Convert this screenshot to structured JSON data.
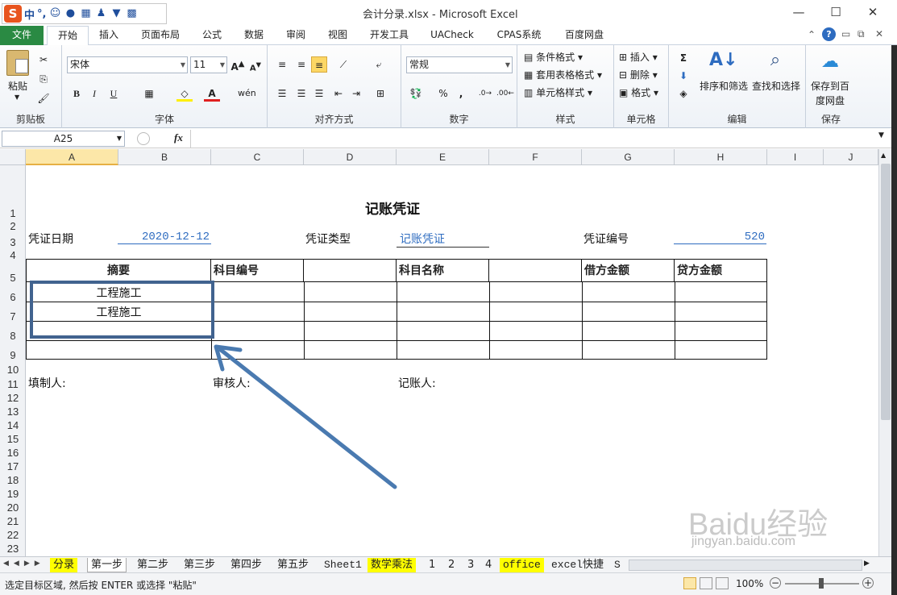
{
  "window": {
    "title": "会计分录.xlsx - Microsoft Excel",
    "minimize": "—",
    "maximize": "☐",
    "close": "✕"
  },
  "ime": {
    "logo": "S",
    "mode": "中",
    "punct": "°,"
  },
  "tabs": [
    "文件",
    "开始",
    "插入",
    "页面布局",
    "公式",
    "数据",
    "审阅",
    "视图",
    "开发工具",
    "UACheck",
    "CPAS系统",
    "百度网盘"
  ],
  "ribbon": {
    "clipboard": {
      "paste": "粘贴",
      "label": "剪贴板"
    },
    "font": {
      "name": "宋体",
      "size": "11",
      "bold": "B",
      "italic": "I",
      "underline": "U",
      "label": "字体"
    },
    "alignment": {
      "label": "对齐方式"
    },
    "number": {
      "format": "常规",
      "percent": "%",
      "comma": ",",
      "label": "数字"
    },
    "styles": {
      "conditional": "条件格式",
      "table": "套用表格格式",
      "cell": "单元格样式",
      "label": "样式"
    },
    "cells": {
      "insert": "插入",
      "delete": "删除",
      "format": "格式",
      "label": "单元格"
    },
    "editing": {
      "sort": "排序和筛选",
      "find": "查找和选择",
      "label": "编辑"
    },
    "save": {
      "button1": "保存到百",
      "button2": "度网盘",
      "label": "保存"
    }
  },
  "formula": {
    "namebox": "A25",
    "fx": "fx",
    "value": ""
  },
  "columns": [
    "A",
    "B",
    "C",
    "D",
    "E",
    "F",
    "G",
    "H",
    "I",
    "J"
  ],
  "rows": [
    "1",
    "2",
    "3",
    "4",
    "5",
    "6",
    "7",
    "8",
    "9",
    "10",
    "11",
    "12",
    "13",
    "14",
    "15",
    "16",
    "17",
    "18",
    "19",
    "20",
    "21",
    "22",
    "23"
  ],
  "sheet": {
    "title": "记账凭证",
    "date_label": "凭证日期",
    "date_value": "2020-12-12",
    "type_label": "凭证类型",
    "type_value": "记账凭证",
    "number_label": "凭证编号",
    "number_value": "520",
    "headers": {
      "summary": "摘要",
      "account_code": "科目编号",
      "account_name": "科目名称",
      "debit": "借方金额",
      "credit": "贷方金额"
    },
    "rows": [
      {
        "summary": "工程施工"
      },
      {
        "summary": "工程施工"
      },
      {
        "summary": ""
      },
      {
        "summary": ""
      }
    ],
    "preparer": "填制人:",
    "reviewer": "审核人:",
    "bookkeeper": "记账人:"
  },
  "sheet_tabs": [
    "分录",
    "第一步",
    "第二步",
    "第三步",
    "第四步",
    "第五步",
    "Sheet1",
    "数学乘法",
    "1",
    "2",
    "3",
    "4",
    "office",
    "excel快捷",
    "S"
  ],
  "status": {
    "message": "选定目标区域, 然后按 ENTER 或选择 \"粘贴\"",
    "zoom": "100%"
  },
  "watermark": {
    "text1": "Baidu经验",
    "text2": "jingyan.baidu.com"
  },
  "colors": {
    "file_tab": "#2a8a43",
    "highlight_box": "#41638f",
    "arrow": "#4a7ab0",
    "blue_text": "#2e6cc0",
    "yellow_tab": "#ffff00"
  }
}
